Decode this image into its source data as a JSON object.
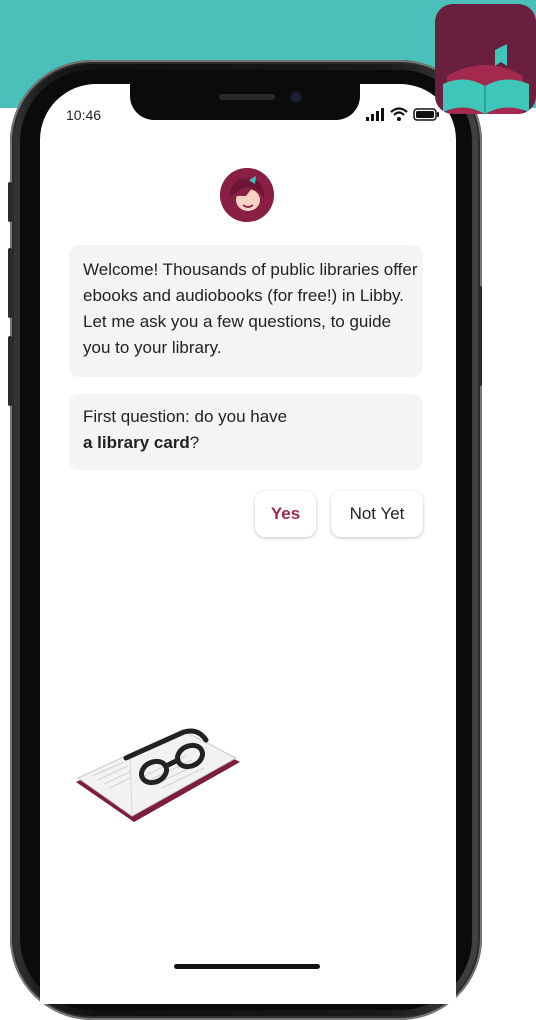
{
  "status_bar": {
    "time": "10:46"
  },
  "chat": {
    "welcome_message": "Welcome! Thousands of public libraries offer ebooks and audiobooks (for free!) in Libby. Let me ask you a few questions, to guide you to your library.",
    "question_prefix": "First question: do you have",
    "question_bold": "a library card",
    "question_suffix": "?"
  },
  "choices": {
    "yes": "Yes",
    "not_yet": "Not Yet"
  },
  "colors": {
    "teal": "#4bbfba",
    "brand_maroon": "#8a1f45",
    "yes_text": "#a0284f",
    "bubble_bg": "#f4f3f6"
  },
  "icons": {
    "app_icon": "libby-book-icon",
    "avatar": "libby-avatar-icon",
    "illustration": "book-with-glasses-icon"
  }
}
